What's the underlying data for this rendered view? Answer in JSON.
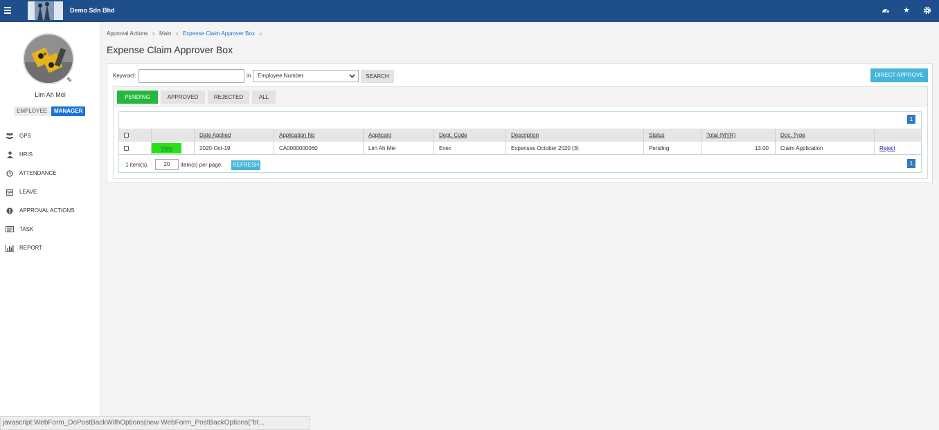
{
  "header": {
    "company": "Demo Sdn Bhd",
    "icons": [
      "menu-icon",
      "dashboard-icon",
      "star-icon",
      "gear-icon"
    ]
  },
  "profile": {
    "name": "Lim Ah Mei",
    "roles": [
      "EMPLOYEE",
      "MANAGER"
    ],
    "active_role": "MANAGER"
  },
  "sidebar": {
    "items": [
      {
        "label": "GPS",
        "icon": "users-icon"
      },
      {
        "label": "HRIS",
        "icon": "user-icon"
      },
      {
        "label": "ATTENDANCE",
        "icon": "clock-icon"
      },
      {
        "label": "LEAVE",
        "icon": "calendar-icon"
      },
      {
        "label": "APPROVAL ACTIONS",
        "icon": "alert-icon"
      },
      {
        "label": "TASK",
        "icon": "list-icon"
      },
      {
        "label": "REPORT",
        "icon": "bar-chart-icon"
      }
    ]
  },
  "breadcrumb": [
    "Approval Actions",
    "Main",
    "Expense Claim Approver Box"
  ],
  "breadcrumb_sep": "»",
  "page_title": "Expense Claim Approver Box",
  "search": {
    "keyword_label": "Keyword:",
    "keyword_value": "",
    "in_label": "in",
    "field_selected": "Employee Number",
    "search_label": "SEARCH",
    "direct_approve_label": "DIRECT APPROVE"
  },
  "tabs": [
    "PENDING",
    "APPROVED",
    "REJECTED",
    "ALL"
  ],
  "active_tab": "PENDING",
  "grid": {
    "columns": [
      "Date Applied",
      "Application No",
      "Applicant",
      "Dept. Code",
      "Description",
      "Status",
      "Total (MYR)",
      "Doc. Type"
    ],
    "rows": [
      {
        "view": "View",
        "date_applied": "2020-Oct-19",
        "application_no": "CA0000000060",
        "applicant": "Lim Ah Mei",
        "dept_code": "Exec",
        "description": "Expenses October 2020 (3)",
        "status": "Pending",
        "total": "13.00",
        "doc_type": "Claim Application",
        "reject": "Reject"
      }
    ],
    "page": "1",
    "items_text": "1 item(s).",
    "page_size": "20",
    "per_page_text": "item(s) per page.",
    "refresh_label": "REFRESH"
  },
  "status_bar": "javascript:WebForm_DoPostBackWithOptions(new WebForm_PostBackOptions(\"bt..."
}
